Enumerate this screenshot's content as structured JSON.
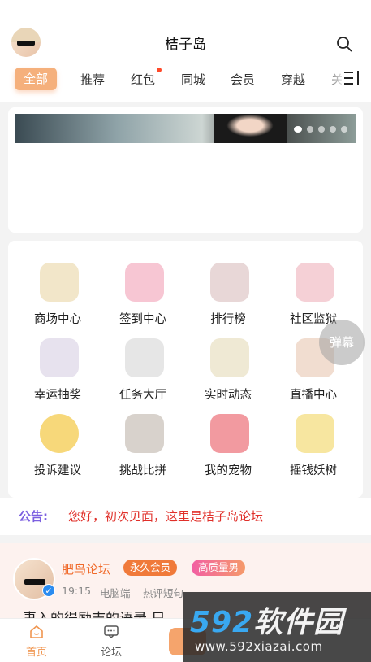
{
  "header": {
    "title": "桔子岛",
    "tabs": [
      {
        "label": "全部",
        "active": true
      },
      {
        "label": "推荐"
      },
      {
        "label": "红包",
        "has_dot": true
      },
      {
        "label": "同城"
      },
      {
        "label": "会员"
      },
      {
        "label": "穿越"
      },
      {
        "label": "关"
      }
    ]
  },
  "banner": {
    "page_count": 5,
    "active_page": 1
  },
  "grid": [
    {
      "label": "商场中心",
      "icon": "bear-wine-icon",
      "color": "#f2e6c9"
    },
    {
      "label": "签到中心",
      "icon": "pink-rabbit-icon",
      "color": "#f7c6d3"
    },
    {
      "label": "排行榜",
      "icon": "girl-chibi-icon",
      "color": "#e8d7d7"
    },
    {
      "label": "社区监狱",
      "icon": "pink-hair-icon",
      "color": "#f5d0d6"
    },
    {
      "label": "幸运抽奖",
      "icon": "white-bird-icon",
      "color": "#e7e2ee"
    },
    {
      "label": "任务大厅",
      "icon": "meme-face-icon",
      "color": "#e6e6e6"
    },
    {
      "label": "实时动态",
      "icon": "meme-fan-icon",
      "color": "#efe9d4"
    },
    {
      "label": "直播中心",
      "icon": "hamster-noodle-icon",
      "color": "#f1ddd0"
    },
    {
      "label": "投诉建议",
      "icon": "yellow-smile-icon",
      "color": "#f7d87a"
    },
    {
      "label": "挑战比拼",
      "icon": "anime-guy-icon",
      "color": "#d8d2cc"
    },
    {
      "label": "我的宠物",
      "icon": "pink-monster-icon",
      "color": "#f29aa0"
    },
    {
      "label": "摇钱妖树",
      "icon": "gold-blast-icon",
      "color": "#f7e6a0"
    }
  ],
  "danmu_label": "弹幕",
  "notice": {
    "label": "公告:",
    "text": "您好，初次见面，这里是桔子岛论坛"
  },
  "post": {
    "author": "肥鸟论坛",
    "badges": [
      "永久会员",
      "高质量男"
    ],
    "time": "19:15",
    "device": "电脑端",
    "tag": "热评短句",
    "body": "妻入的得励志的语录 只"
  },
  "bottom_nav": [
    {
      "label": "首页",
      "active": true,
      "icon": "home-icon"
    },
    {
      "label": "论坛",
      "icon": "chat-icon"
    }
  ],
  "watermark": {
    "brand_num": "592",
    "brand_cn": "软件园",
    "url": "www.592xiazai.com"
  },
  "colors": {
    "accent": "#f5b07c",
    "notice_label": "#7b5fe0",
    "notice_text": "#e0302a",
    "author": "#f06a2a"
  }
}
